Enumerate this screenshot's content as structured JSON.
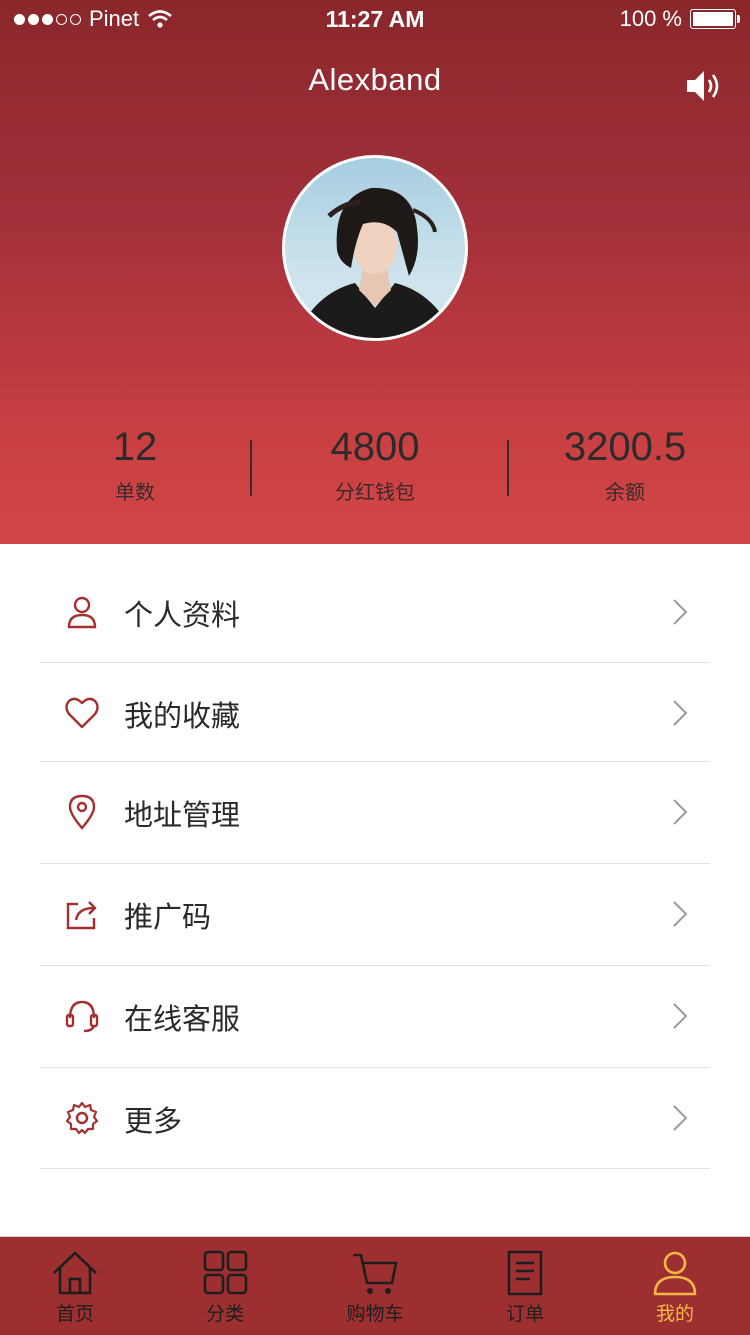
{
  "status_bar": {
    "carrier": "Pinet",
    "time": "11:27 AM",
    "battery": "100 %"
  },
  "header": {
    "title": "Alexband"
  },
  "stats": [
    {
      "value": "12",
      "label": "单数"
    },
    {
      "value": "4800",
      "label": "分红钱包"
    },
    {
      "value": "3200.5",
      "label": "余额"
    }
  ],
  "menu": [
    {
      "label": "个人资料",
      "icon": "person-icon"
    },
    {
      "label": "我的收藏",
      "icon": "heart-icon"
    },
    {
      "label": "地址管理",
      "icon": "location-pin-icon"
    },
    {
      "label": "推广码",
      "icon": "share-icon"
    },
    {
      "label": "在线客服",
      "icon": "headset-icon"
    },
    {
      "label": "更多",
      "icon": "gear-icon"
    }
  ],
  "tabs": [
    {
      "label": "首页",
      "icon": "home-icon"
    },
    {
      "label": "分类",
      "icon": "grid-icon"
    },
    {
      "label": "购物车",
      "icon": "cart-icon"
    },
    {
      "label": "订单",
      "icon": "order-icon"
    },
    {
      "label": "我的",
      "icon": "user-icon",
      "active": true
    }
  ],
  "colors": {
    "header_top": "#8a272b",
    "header_bottom": "#d14647",
    "accent": "#a3302f",
    "tab_active": "#f5b845"
  }
}
